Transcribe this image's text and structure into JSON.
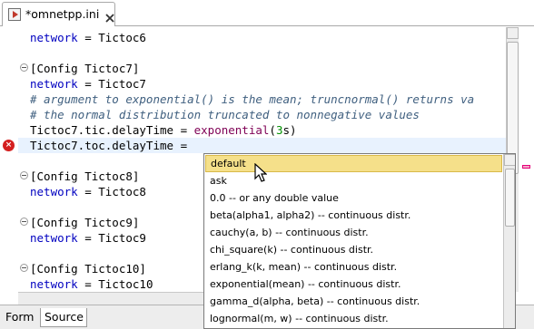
{
  "tab": {
    "title": "*omnetpp.ini",
    "icon": "ini-file-icon"
  },
  "editor": {
    "lines": [
      {
        "parts": [
          {
            "t": "network",
            "c": "kw"
          },
          {
            "t": " = Tictoc6",
            "c": ""
          }
        ]
      },
      {
        "parts": []
      },
      {
        "parts": [
          {
            "t": "[Config Tictoc7]",
            "c": ""
          }
        ]
      },
      {
        "parts": [
          {
            "t": "network",
            "c": "kw"
          },
          {
            "t": " = Tictoc7",
            "c": ""
          }
        ]
      },
      {
        "parts": [
          {
            "t": "# argument to exponential() is the mean; truncnormal() returns va",
            "c": "cm"
          }
        ]
      },
      {
        "parts": [
          {
            "t": "# the normal distribution truncated to nonnegative values",
            "c": "cm"
          }
        ]
      },
      {
        "parts": [
          {
            "t": "Tictoc7.tic.delayTime = ",
            "c": ""
          },
          {
            "t": "exponential",
            "c": "fn"
          },
          {
            "t": "(",
            "c": ""
          },
          {
            "t": "3",
            "c": "num"
          },
          {
            "t": "s)",
            "c": ""
          }
        ]
      },
      {
        "parts": [
          {
            "t": "Tictoc7.toc.delayTime = ",
            "c": ""
          }
        ]
      },
      {
        "parts": []
      },
      {
        "parts": [
          {
            "t": "[Config Tictoc8]",
            "c": ""
          }
        ]
      },
      {
        "parts": [
          {
            "t": "network",
            "c": "kw"
          },
          {
            "t": " = Tictoc8",
            "c": ""
          }
        ]
      },
      {
        "parts": []
      },
      {
        "parts": [
          {
            "t": "[Config Tictoc9]",
            "c": ""
          }
        ]
      },
      {
        "parts": [
          {
            "t": "network",
            "c": "kw"
          },
          {
            "t": " = Tictoc9",
            "c": ""
          }
        ]
      },
      {
        "parts": []
      },
      {
        "parts": [
          {
            "t": "[Config Tictoc10]",
            "c": ""
          }
        ]
      },
      {
        "parts": [
          {
            "t": "network",
            "c": "kw"
          },
          {
            "t": " = Tictoc10",
            "c": ""
          }
        ]
      }
    ],
    "colors": {
      "keyword": "#0000c0",
      "comment": "#3f5f7f",
      "function": "#7f0055",
      "number": "#009000",
      "error": "#d41f1f"
    }
  },
  "content_assist": {
    "selected_index": 0,
    "items": [
      "default",
      "ask",
      "0.0 -- or any double value",
      "beta(alpha1, alpha2) -- continuous distr.",
      "cauchy(a, b) -- continuous distr.",
      "chi_square(k) -- continuous distr.",
      "erlang_k(k, mean) -- continuous distr.",
      "exponential(mean) -- continuous distr.",
      "gamma_d(alpha, beta) -- continuous distr.",
      "lognormal(m, w) -- continuous distr."
    ]
  },
  "bottom_tabs": {
    "form": "Form",
    "source": "Source",
    "active": "Source"
  }
}
